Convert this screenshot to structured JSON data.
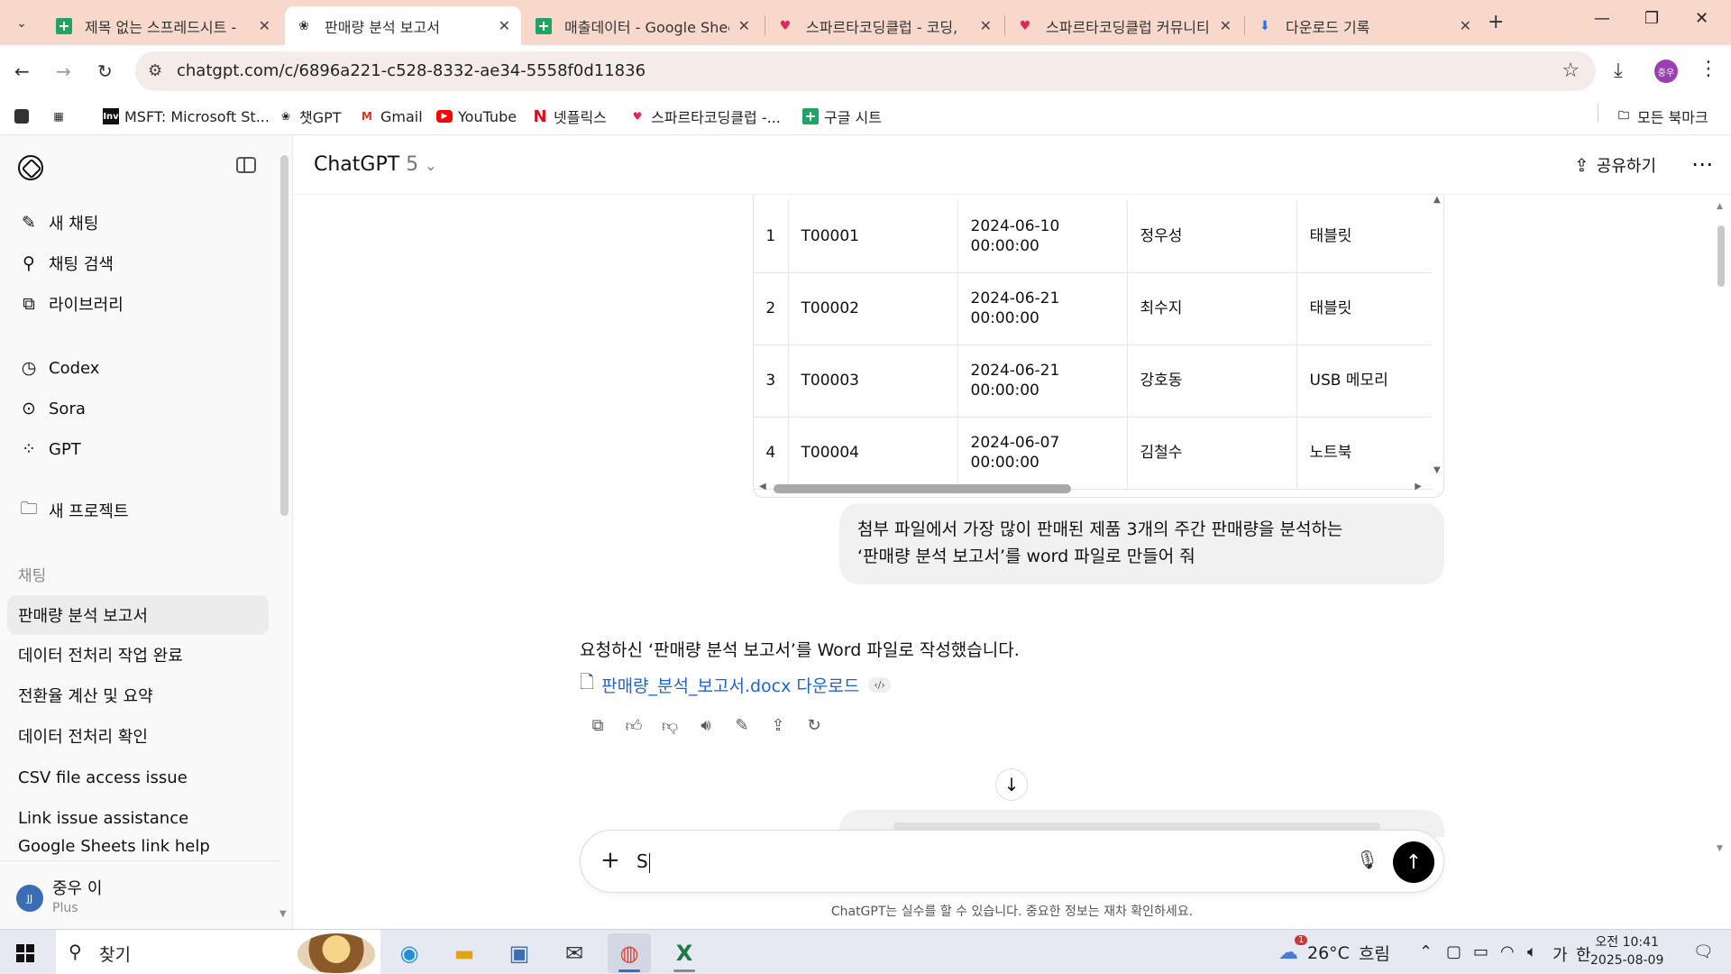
{
  "browser": {
    "tabs": [
      {
        "title": "제목 없는 스프레드시트 - ",
        "icon": "google-sheets-icon"
      },
      {
        "title": "판매량 분석 보고서",
        "icon": "openai-icon"
      },
      {
        "title": "매출데이터 - Google Shee",
        "icon": "google-sheets-icon"
      },
      {
        "title": "스파르타코딩클럽 - 코딩, ",
        "icon": "heart-icon"
      },
      {
        "title": "스파르타코딩클럽 커뮤니티",
        "icon": "heart-icon"
      },
      {
        "title": "다운로드 기록",
        "icon": "download-icon"
      }
    ],
    "url": "chatgpt.com/c/6896a221-c528-8332-ae34-5558f0d11836",
    "profile_initials": "중우",
    "bookmarks": [
      {
        "label": "MSFT: Microsoft St...",
        "icon": "investing-icon"
      },
      {
        "label": "챗GPT",
        "icon": "openai-icon"
      },
      {
        "label": "Gmail",
        "icon": "gmail-icon"
      },
      {
        "label": "YouTube",
        "icon": "youtube-icon"
      },
      {
        "label": "넷플릭스",
        "icon": "netflix-icon"
      },
      {
        "label": "스파르타코딩클럽 -...",
        "icon": "heart-icon"
      },
      {
        "label": "구글 시트",
        "icon": "google-sheets-icon"
      }
    ],
    "all_bookmarks": "모든 북마크"
  },
  "sidebar": {
    "top_items": [
      {
        "label": "새 채팅",
        "icon": "edit-icon"
      },
      {
        "label": "채팅 검색",
        "icon": "search-icon"
      },
      {
        "label": "라이브러리",
        "icon": "library-icon"
      }
    ],
    "tool_items": [
      {
        "label": "Codex",
        "icon": "codex-icon"
      },
      {
        "label": "Sora",
        "icon": "sora-icon"
      },
      {
        "label": "GPT",
        "icon": "gpt-grid-icon"
      }
    ],
    "new_project": "새 프로젝트",
    "section_label": "채팅",
    "chats": [
      "판매량 분석 보고서",
      "데이터 전처리 작업 완료",
      "전환율 계산 및 요약",
      "데이터 전처리 확인",
      "CSV file access issue",
      "Link issue assistance",
      "Google Sheets link help"
    ],
    "user": {
      "initials": "JJ",
      "name": "중우 이",
      "plan": "Plus"
    }
  },
  "header": {
    "model_name": "ChatGPT",
    "model_version": "5",
    "share_label": "공유하기"
  },
  "data_table": {
    "rows": [
      {
        "idx": "1",
        "id": "T00001",
        "date_line1": "2024-06-10",
        "date_line2": "00:00:00",
        "name": "정우성",
        "product": "태블릿"
      },
      {
        "idx": "2",
        "id": "T00002",
        "date_line1": "2024-06-21",
        "date_line2": "00:00:00",
        "name": "최수지",
        "product": "태블릿"
      },
      {
        "idx": "3",
        "id": "T00003",
        "date_line1": "2024-06-21",
        "date_line2": "00:00:00",
        "name": "강호동",
        "product": "USB 메모리"
      },
      {
        "idx": "4",
        "id": "T00004",
        "date_line1": "2024-06-07",
        "date_line2": "00:00:00",
        "name": "김철수",
        "product": "노트북"
      }
    ]
  },
  "conversation": {
    "user_message_line1": "첨부 파일에서 가장 많이 판매된 제품 3개의 주간 판매량을 분석하는",
    "user_message_line2": "‘판매량 분석 보고서’를 word 파일로 만들어 줘",
    "assistant_message": "요청하신 ‘판매량 분석 보고서’를 Word 파일로 작성했습니다.",
    "file_link": "판매량_분석_보고서.docx 다운로드",
    "code_chip": "‹/›"
  },
  "composer": {
    "input_value": "S"
  },
  "disclaimer": "ChatGPT는 실수를 할 수 있습니다. 중요한 정보는 재차 확인하세요.",
  "taskbar": {
    "search_placeholder": "찾기",
    "weather_temp": "26°C",
    "weather_text": "흐림",
    "weather_badge": "1",
    "ime_mode": "가",
    "ime_lang": "한",
    "time": "오전 10:41",
    "date": "2025-08-09"
  }
}
